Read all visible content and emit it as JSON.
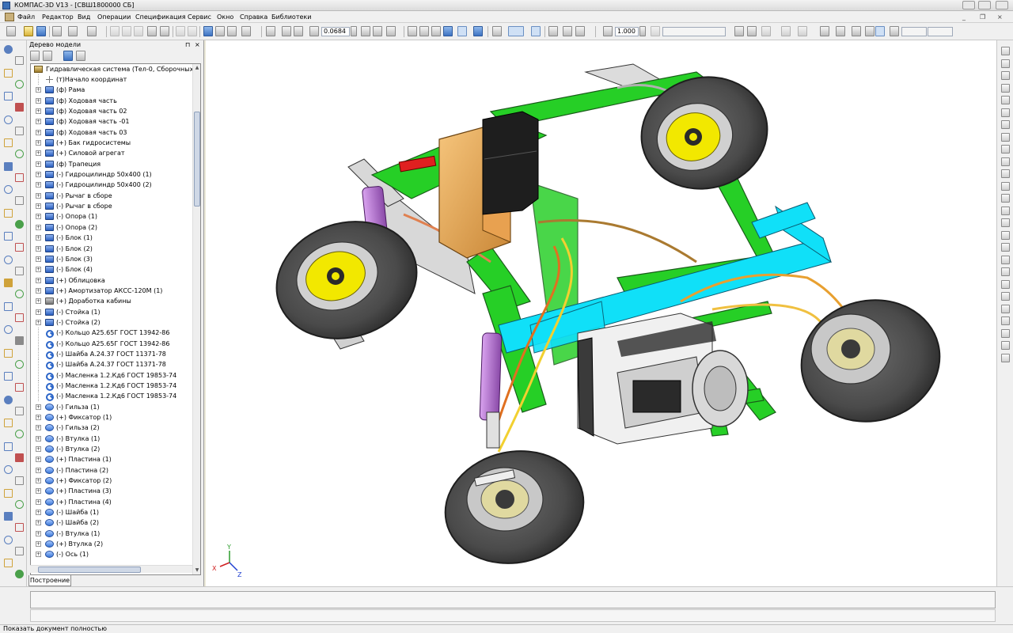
{
  "window": {
    "title": "КОМПАС-3D V13 - [СВШ1800000 СБ]"
  },
  "menu": {
    "items": [
      "Файл",
      "Редактор",
      "Вид",
      "Операции",
      "Спецификация",
      "Сервис",
      "Окно",
      "Справка",
      "Библиотеки"
    ]
  },
  "toolbar": {
    "zoom_value": "0.0684",
    "step_value": "1.000"
  },
  "tree": {
    "panel_title": "Дерево модели",
    "pin_glyph": "⊓",
    "close_glyph": "×",
    "root_label": "Гидравлическая система (Тел-0, Сборочных един",
    "items": [
      {
        "label": "(т)Начало координат",
        "icon": "origin-icon",
        "expander": false
      },
      {
        "label": "(ф) Рама",
        "icon": "assembly-icon",
        "expander": true
      },
      {
        "label": "(ф) Ходовая часть",
        "icon": "assembly-icon",
        "expander": true
      },
      {
        "label": "(ф) Ходовая часть 02",
        "icon": "assembly-icon",
        "expander": true
      },
      {
        "label": "(ф) Ходовая часть  -01",
        "icon": "assembly-icon",
        "expander": true
      },
      {
        "label": "(ф) Ходовая часть 03",
        "icon": "assembly-icon",
        "expander": true
      },
      {
        "label": "(+) Бак гидросистемы",
        "icon": "assembly-icon",
        "expander": true
      },
      {
        "label": "(+) Силовой агрегат",
        "icon": "assembly-icon",
        "expander": true
      },
      {
        "label": "(ф) Трапеция",
        "icon": "assembly-icon",
        "expander": true
      },
      {
        "label": "(-) Гидроцилиндр 50х400 (1)",
        "icon": "assembly-icon",
        "expander": true
      },
      {
        "label": "(-) Гидроцилиндр 50х400 (2)",
        "icon": "assembly-icon",
        "expander": true
      },
      {
        "label": "(-) Рычаг в сборе",
        "icon": "assembly-icon",
        "expander": true
      },
      {
        "label": "(-) Рычаг в сборе",
        "icon": "assembly-icon",
        "expander": true
      },
      {
        "label": "(-) Опора (1)",
        "icon": "assembly-icon",
        "expander": true
      },
      {
        "label": "(-) Опора (2)",
        "icon": "assembly-icon",
        "expander": true
      },
      {
        "label": "(-) Блок (1)",
        "icon": "assembly-icon",
        "expander": true
      },
      {
        "label": "(-) Блок (2)",
        "icon": "assembly-icon",
        "expander": true
      },
      {
        "label": "(-) Блок (3)",
        "icon": "assembly-icon",
        "expander": true
      },
      {
        "label": "(-) Блок (4)",
        "icon": "assembly-icon",
        "expander": true
      },
      {
        "label": "(+) Облицовка",
        "icon": "assembly-icon",
        "expander": true
      },
      {
        "label": "(+) Амортизатор  АКСС-120М (1)",
        "icon": "assembly-icon",
        "expander": true
      },
      {
        "label": "(+) Доработка кабины",
        "icon": "gray-assembly-icon",
        "expander": true
      },
      {
        "label": "(-) Стойка (1)",
        "icon": "assembly-icon",
        "expander": true
      },
      {
        "label": "(-) Стойка (2)",
        "icon": "assembly-icon",
        "expander": true
      },
      {
        "label": "(-) Кольцо А25.65Г ГОСТ 13942-86",
        "icon": "standard-part-icon",
        "expander": false
      },
      {
        "label": "(-) Кольцо А25.65Г ГОСТ 13942-86",
        "icon": "standard-part-icon",
        "expander": false
      },
      {
        "label": "(-) Шайба А.24.37 ГОСТ 11371-78",
        "icon": "standard-part-icon",
        "expander": false
      },
      {
        "label": "(-) Шайба А.24.37 ГОСТ 11371-78",
        "icon": "standard-part-icon",
        "expander": false
      },
      {
        "label": "(-) Масленка 1.2.Кд6 ГОСТ 19853-74",
        "icon": "standard-part-icon",
        "expander": false
      },
      {
        "label": "(-) Масленка 1.2.Кд6 ГОСТ 19853-74",
        "icon": "standard-part-icon",
        "expander": false
      },
      {
        "label": "(-) Масленка 1.2.Кд6 ГОСТ 19853-74",
        "icon": "standard-part-icon",
        "expander": false
      },
      {
        "label": "(-) Гильза (1)",
        "icon": "part-icon",
        "expander": true
      },
      {
        "label": "(+) Фиксатор (1)",
        "icon": "part-icon",
        "expander": true
      },
      {
        "label": "(-) Гильза (2)",
        "icon": "part-icon",
        "expander": true
      },
      {
        "label": "(-) Втулка (1)",
        "icon": "part-icon",
        "expander": true
      },
      {
        "label": "(-) Втулка (2)",
        "icon": "part-icon",
        "expander": true
      },
      {
        "label": "(+) Пластина (1)",
        "icon": "part-icon",
        "expander": true
      },
      {
        "label": "(-) Пластина (2)",
        "icon": "part-icon",
        "expander": true
      },
      {
        "label": "(+) Фиксатор (2)",
        "icon": "part-icon",
        "expander": true
      },
      {
        "label": "(+) Пластина (3)",
        "icon": "part-icon",
        "expander": true
      },
      {
        "label": "(+) Пластина (4)",
        "icon": "part-icon",
        "expander": true
      },
      {
        "label": "(-) Шайба (1)",
        "icon": "part-icon",
        "expander": true
      },
      {
        "label": "(-) Шайба (2)",
        "icon": "part-icon",
        "expander": true
      },
      {
        "label": "(-) Втулка (1)",
        "icon": "part-icon",
        "expander": true
      },
      {
        "label": "(+) Втулка (2)",
        "icon": "part-icon",
        "expander": true
      },
      {
        "label": "(-) Ось (1)",
        "icon": "part-icon",
        "expander": true
      }
    ],
    "tab_label": "Построение"
  },
  "axes": {
    "x": "X",
    "y": "Y",
    "z": "Z"
  },
  "status": {
    "text": "Показать документ полностью"
  },
  "colors": {
    "frame_green": "#22cc22",
    "beam_cyan": "#00e5ff",
    "hub_yellow": "#f2e800",
    "tank_orange": "#e8a050",
    "tire_gray": "#555555",
    "cylinder_violet": "#b070d0"
  }
}
